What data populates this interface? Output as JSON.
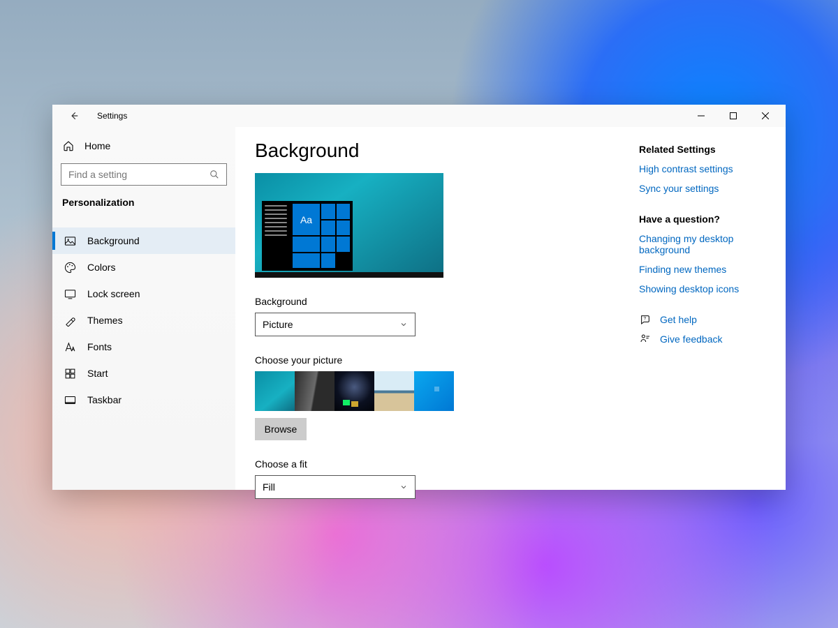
{
  "titlebar": {
    "title": "Settings"
  },
  "sidebar": {
    "home_label": "Home",
    "search_placeholder": "Find a setting",
    "category_label": "Personalization",
    "items": [
      {
        "label": "Background",
        "icon": "picture-icon",
        "active": true
      },
      {
        "label": "Colors",
        "icon": "palette-icon"
      },
      {
        "label": "Lock screen",
        "icon": "lockscreen-icon"
      },
      {
        "label": "Themes",
        "icon": "themes-icon"
      },
      {
        "label": "Fonts",
        "icon": "fonts-icon"
      },
      {
        "label": "Start",
        "icon": "start-icon"
      },
      {
        "label": "Taskbar",
        "icon": "taskbar-icon"
      }
    ]
  },
  "main": {
    "page_title": "Background",
    "preview_sample_text": "Aa",
    "background_label": "Background",
    "background_value": "Picture",
    "choose_picture_label": "Choose your picture",
    "browse_label": "Browse",
    "choose_fit_label": "Choose a fit",
    "fit_value": "Fill"
  },
  "aside": {
    "related_heading": "Related Settings",
    "related_links": [
      "High contrast settings",
      "Sync your settings"
    ],
    "question_heading": "Have a question?",
    "question_links": [
      "Changing my desktop background",
      "Finding new themes",
      "Showing desktop icons"
    ],
    "get_help_label": "Get help",
    "give_feedback_label": "Give feedback"
  }
}
